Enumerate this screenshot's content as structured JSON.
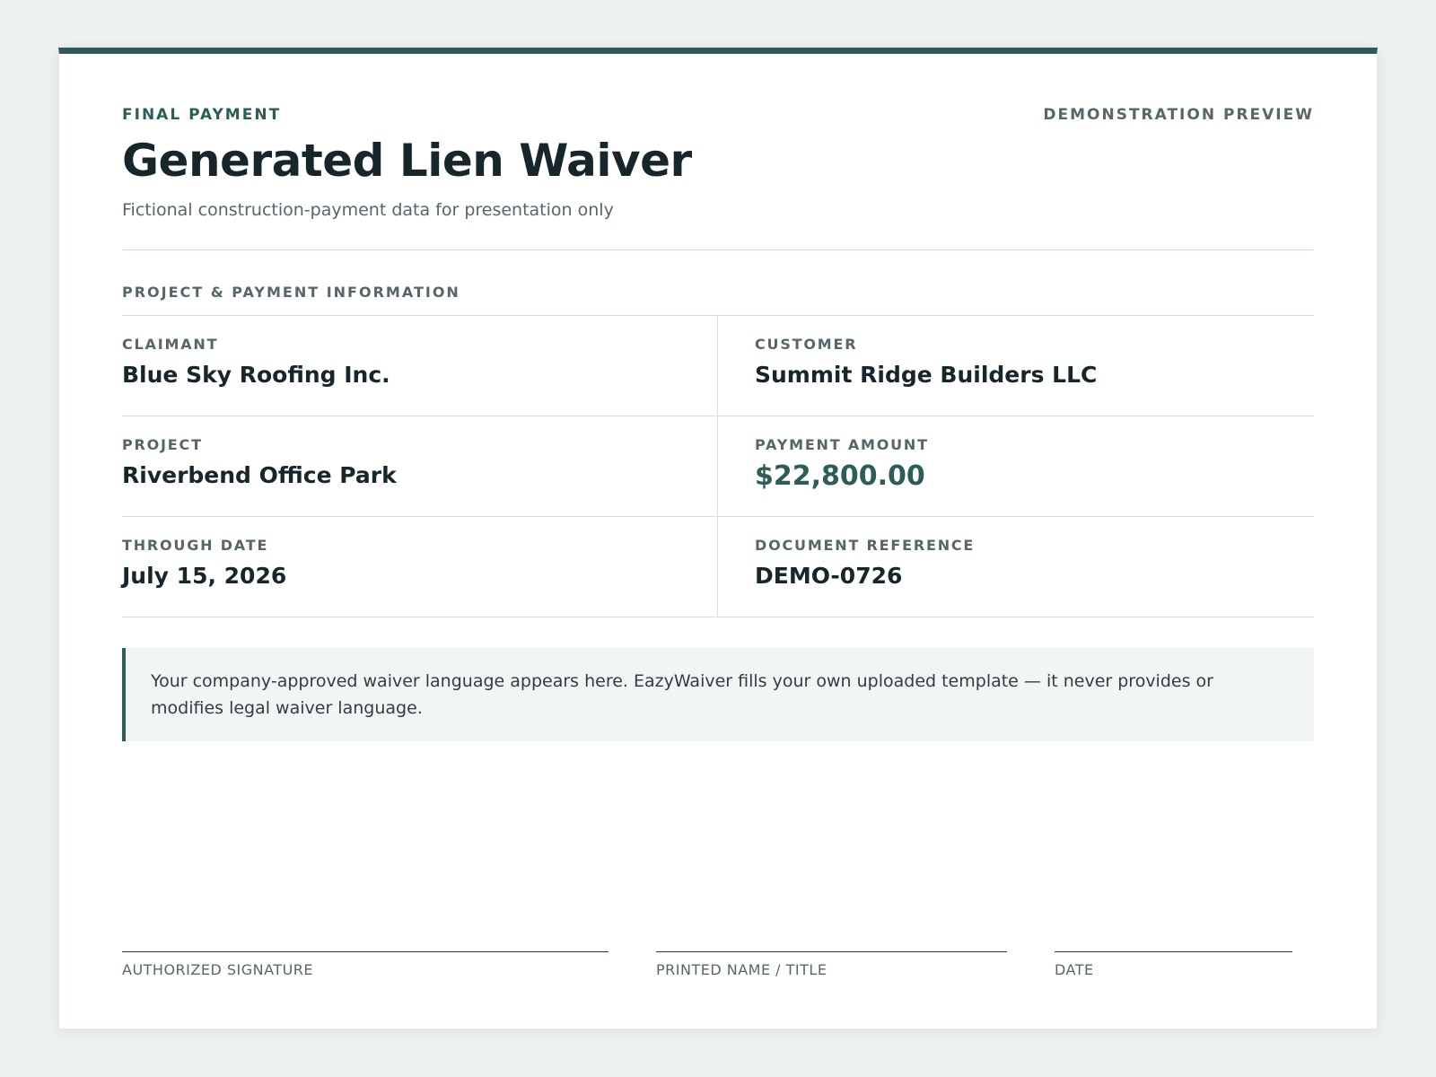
{
  "header": {
    "eyebrow": "FINAL PAYMENT",
    "preview_tag": "DEMONSTRATION PREVIEW",
    "title": "Generated Lien Waiver",
    "subtitle": "Fictional construction-payment data for presentation only"
  },
  "section": {
    "heading": "PROJECT & PAYMENT INFORMATION"
  },
  "fields": {
    "claimant": {
      "label": "CLAIMANT",
      "value": "Blue Sky Roofing Inc."
    },
    "customer": {
      "label": "CUSTOMER",
      "value": "Summit Ridge Builders LLC"
    },
    "project": {
      "label": "PROJECT",
      "value": "Riverbend Office Park"
    },
    "payment_amount": {
      "label": "PAYMENT AMOUNT",
      "value": "$22,800.00"
    },
    "through_date": {
      "label": "THROUGH DATE",
      "value": "July 15, 2026"
    },
    "document_reference": {
      "label": "DOCUMENT REFERENCE",
      "value": "DEMO-0726"
    }
  },
  "notice": {
    "text": "Your company-approved waiver language appears here. EazyWaiver fills your own uploaded template — it never provides or modifies legal waiver language."
  },
  "signatures": {
    "authorized_signature": "AUTHORIZED SIGNATURE",
    "printed_name_title": "PRINTED NAME / TITLE",
    "date": "DATE"
  },
  "colors": {
    "accent": "#2c5d58",
    "page_background": "#edf1f0",
    "notice_background": "#f1f5f4"
  }
}
